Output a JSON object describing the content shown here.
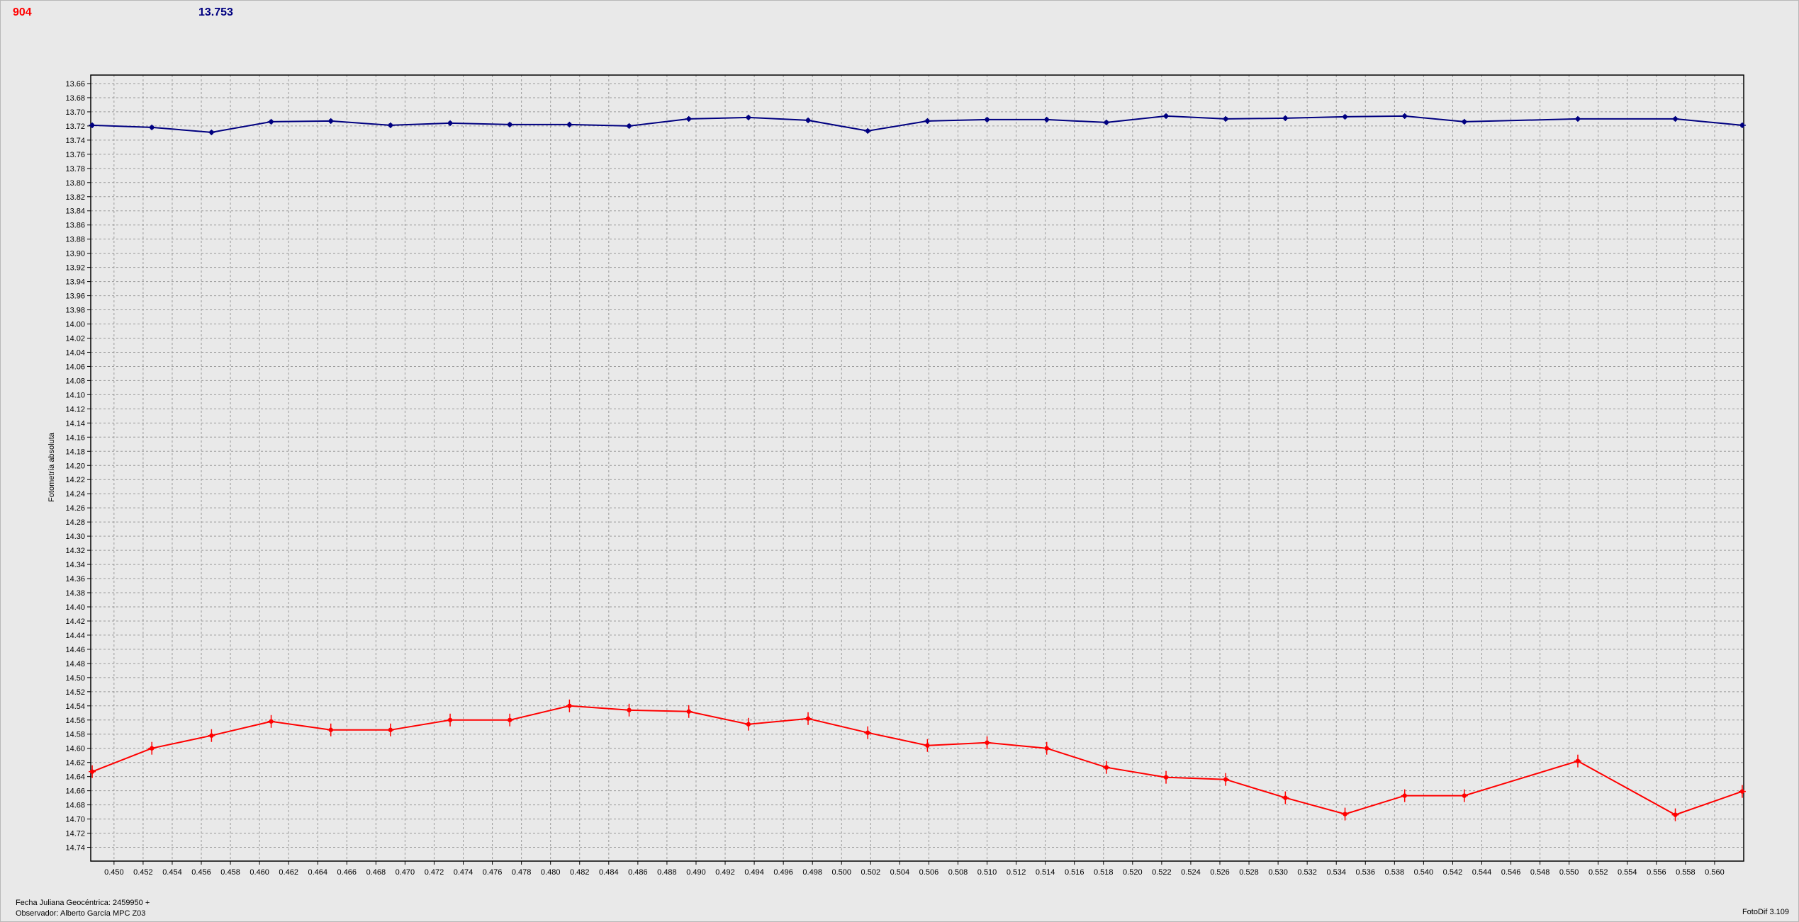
{
  "header": {
    "left_value": "904",
    "right_value": "13.753"
  },
  "footer": {
    "julian_date": "Fecha Juliana Geocéntrica: 2459950 +",
    "observer": "Observador: Alberto García MPC Z03",
    "software": "FotoDif 3.109"
  },
  "colors": {
    "series_blue": "#000080",
    "series_red": "#ff0000",
    "grid": "#9a9a9a",
    "plot_bg": "#e9e9e9"
  },
  "chart_data": {
    "type": "line",
    "ylabel": "Fotometría absoluta",
    "xlabel": "",
    "xlim": [
      0.4484,
      0.562
    ],
    "ylim": [
      13.648,
      14.7595
    ],
    "y_inverted": true,
    "grid": true,
    "xticks": [
      "0.450",
      "0.452",
      "0.454",
      "0.456",
      "0.458",
      "0.460",
      "0.462",
      "0.464",
      "0.466",
      "0.468",
      "0.470",
      "0.472",
      "0.474",
      "0.476",
      "0.478",
      "0.480",
      "0.482",
      "0.484",
      "0.486",
      "0.488",
      "0.490",
      "0.492",
      "0.494",
      "0.496",
      "0.498",
      "0.500",
      "0.502",
      "0.504",
      "0.506",
      "0.508",
      "0.510",
      "0.512",
      "0.514",
      "0.516",
      "0.518",
      "0.520",
      "0.522",
      "0.524",
      "0.526",
      "0.528",
      "0.530",
      "0.532",
      "0.534",
      "0.536",
      "0.538",
      "0.540",
      "0.542",
      "0.544",
      "0.546",
      "0.548",
      "0.550",
      "0.552",
      "0.554",
      "0.556",
      "0.558",
      "0.560"
    ],
    "yticks": [
      "13.66",
      "13.68",
      "13.70",
      "13.72",
      "13.74",
      "13.76",
      "13.78",
      "13.80",
      "13.82",
      "13.84",
      "13.86",
      "13.88",
      "13.90",
      "13.92",
      "13.94",
      "13.96",
      "13.98",
      "14.00",
      "14.02",
      "14.04",
      "14.06",
      "14.08",
      "14.10",
      "14.12",
      "14.14",
      "14.16",
      "14.18",
      "14.20",
      "14.22",
      "14.24",
      "14.26",
      "14.28",
      "14.30",
      "14.32",
      "14.34",
      "14.36",
      "14.38",
      "14.40",
      "14.42",
      "14.44",
      "14.46",
      "14.48",
      "14.50",
      "14.52",
      "14.54",
      "14.56",
      "14.58",
      "14.60",
      "14.62",
      "14.64",
      "14.66",
      "14.68",
      "14.70",
      "14.72",
      "14.74"
    ],
    "x": [
      0.4485,
      0.4526,
      0.4567,
      0.4608,
      0.4649,
      0.469,
      0.4731,
      0.4772,
      0.4813,
      0.4854,
      0.4895,
      0.4936,
      0.4977,
      0.5018,
      0.5059,
      0.51,
      0.5141,
      0.5182,
      0.5223,
      0.5264,
      0.5305,
      0.5346,
      0.5387,
      0.5428,
      0.5506,
      0.5573,
      0.5619
    ],
    "series": [
      {
        "color": "#000080",
        "values": [
          13.719,
          13.722,
          13.729,
          13.714,
          13.713,
          13.719,
          13.716,
          13.718,
          13.718,
          13.72,
          13.71,
          13.708,
          13.712,
          13.727,
          13.713,
          13.711,
          13.711,
          13.715,
          13.706,
          13.71,
          13.709,
          13.707,
          13.706,
          13.714,
          13.71,
          13.71,
          13.719
        ],
        "errors": [
          0.004,
          0.004,
          0.004,
          0.004,
          0.004,
          0.004,
          0.004,
          0.004,
          0.004,
          0.004,
          0.004,
          0.004,
          0.004,
          0.004,
          0.004,
          0.004,
          0.004,
          0.004,
          0.004,
          0.004,
          0.004,
          0.004,
          0.004,
          0.004,
          0.004,
          0.004,
          0.004
        ]
      },
      {
        "color": "#ff0000",
        "values": [
          14.633,
          14.6,
          14.582,
          14.562,
          14.574,
          14.574,
          14.56,
          14.56,
          14.54,
          14.546,
          14.548,
          14.566,
          14.558,
          14.578,
          14.596,
          14.592,
          14.6,
          14.627,
          14.641,
          14.644,
          14.67,
          14.693,
          14.667,
          14.667,
          14.618,
          14.694,
          14.661
        ],
        "errors": [
          0.009,
          0.009,
          0.009,
          0.009,
          0.009,
          0.009,
          0.009,
          0.009,
          0.009,
          0.009,
          0.009,
          0.009,
          0.009,
          0.009,
          0.009,
          0.009,
          0.009,
          0.009,
          0.009,
          0.009,
          0.009,
          0.009,
          0.009,
          0.009,
          0.009,
          0.009,
          0.009
        ]
      }
    ]
  }
}
